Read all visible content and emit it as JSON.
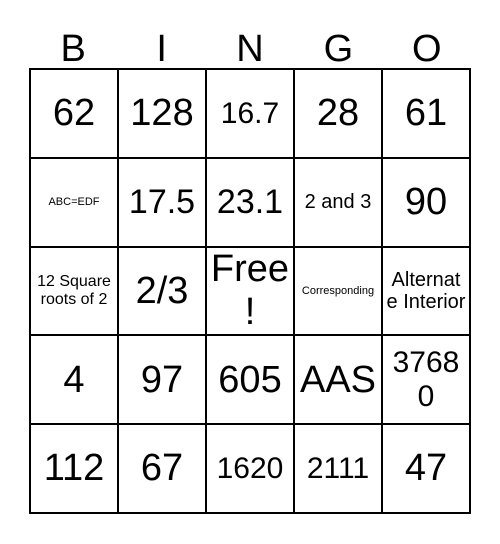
{
  "card": {
    "header": {
      "letters": [
        "B",
        "I",
        "N",
        "G",
        "O"
      ]
    },
    "rows": [
      {
        "cells": [
          {
            "text": "62",
            "size": "xl"
          },
          {
            "text": "128",
            "size": "xl"
          },
          {
            "text": "16.7",
            "size": "md"
          },
          {
            "text": "28",
            "size": "xl"
          },
          {
            "text": "61",
            "size": "xl"
          }
        ]
      },
      {
        "cells": [
          {
            "text": "ABC=EDF",
            "size": "xxs"
          },
          {
            "text": "17.5",
            "size": "lg"
          },
          {
            "text": "23.1",
            "size": "lg"
          },
          {
            "text": "2 and 3",
            "size": "sm"
          },
          {
            "text": "90",
            "size": "xl"
          }
        ]
      },
      {
        "cells": [
          {
            "text": "12 Square roots of 2",
            "size": "xs"
          },
          {
            "text": "2/3",
            "size": "xl"
          },
          {
            "text": "Free!",
            "size": "xl"
          },
          {
            "text": "Corresponding",
            "size": "xxs"
          },
          {
            "text": "Alternate Interior",
            "size": "sm"
          }
        ]
      },
      {
        "cells": [
          {
            "text": "4",
            "size": "xl"
          },
          {
            "text": "97",
            "size": "xl"
          },
          {
            "text": "605",
            "size": "xl"
          },
          {
            "text": "AAS",
            "size": "xl"
          },
          {
            "text": "37680",
            "size": "md"
          }
        ]
      },
      {
        "cells": [
          {
            "text": "112",
            "size": "xl"
          },
          {
            "text": "67",
            "size": "xl"
          },
          {
            "text": "1620",
            "size": "md"
          },
          {
            "text": "2111",
            "size": "md"
          },
          {
            "text": "47",
            "size": "xl"
          }
        ]
      }
    ],
    "colors": {
      "border": "#000000",
      "background": "#ffffff",
      "text": "#000000"
    }
  }
}
